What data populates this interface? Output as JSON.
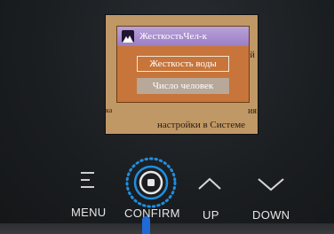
{
  "screen": {
    "background_partial_texts": [
      "ей",
      "ка",
      "ия",
      "настройки  в Системе"
    ],
    "dialog": {
      "icon": "mountain-icon",
      "title": "ЖесткостьЧел-к",
      "options": [
        "Жесткость воды",
        "Число человек"
      ],
      "selected_index": 1
    }
  },
  "buttons": {
    "menu": {
      "label": "MENU",
      "icon": "menu-icon"
    },
    "confirm": {
      "label": "CONFIRM",
      "icon": "confirm-icon"
    },
    "up": {
      "label": "UP",
      "icon": "chevron-up-icon"
    },
    "down": {
      "label": "DOWN",
      "icon": "chevron-down-icon"
    }
  },
  "colors": {
    "screen_bg": "#c09866",
    "dialog_bg": "#c7753a",
    "header_bg": "#9b7ec6",
    "selected_bg": "#b7a89a",
    "confirm_ring": "#1f8fe0",
    "cursor": "#1f6ad6"
  }
}
